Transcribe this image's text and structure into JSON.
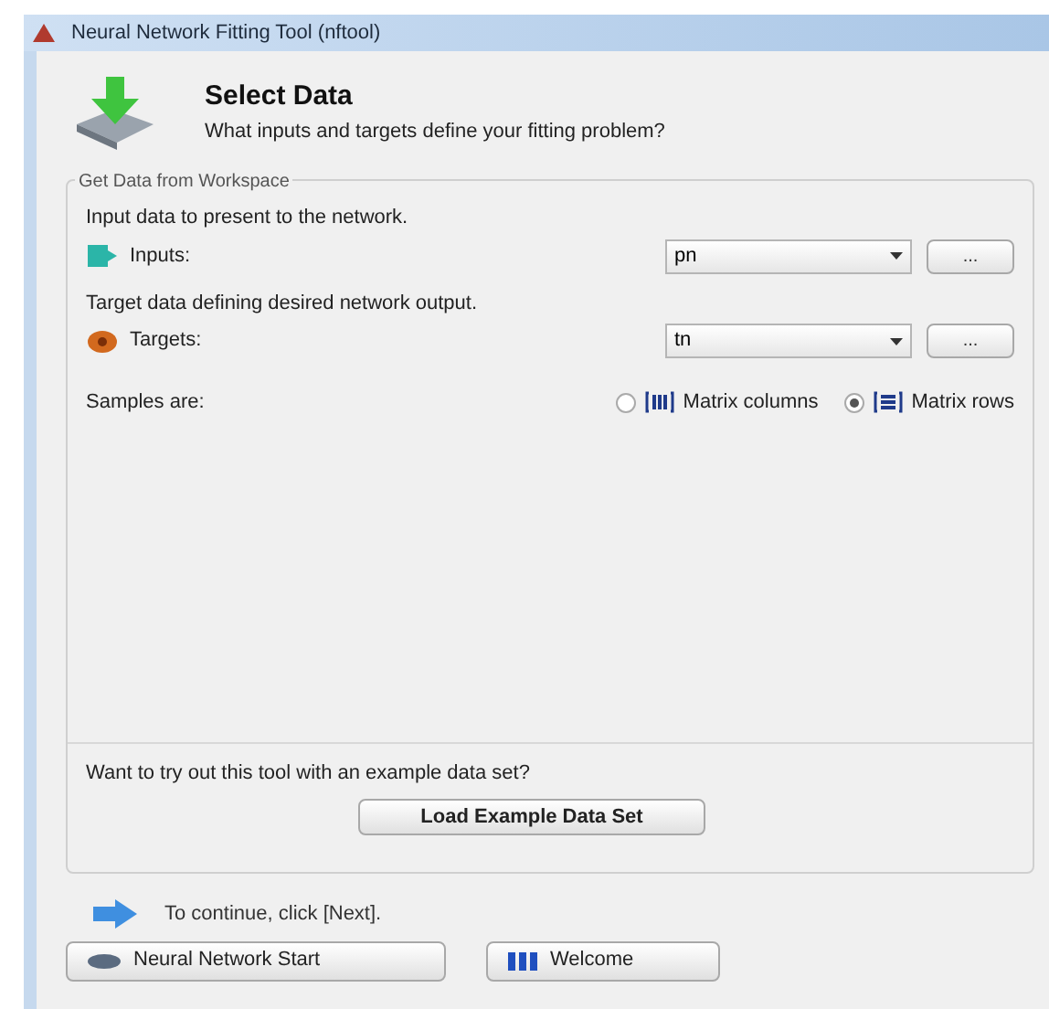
{
  "window": {
    "title": "Neural Network Fitting Tool (nftool)"
  },
  "header": {
    "title": "Select Data",
    "subtitle": "What inputs and targets define your fitting problem?"
  },
  "group": {
    "title": "Get Data from Workspace",
    "fields": [
      {
        "kind": "inputs",
        "hint": "Input data to present to the network.",
        "label": "Inputs:",
        "value": "pn",
        "browse": "..."
      },
      {
        "kind": "targets",
        "hint": "Target data defining desired network output.",
        "label": "Targets:",
        "value": "tn",
        "browse": "..."
      }
    ],
    "samples": {
      "label": "Samples are:",
      "options": [
        {
          "kind": "columns",
          "label": "Matrix columns",
          "selected": false
        },
        {
          "kind": "rows",
          "label": "Matrix rows",
          "selected": true
        }
      ]
    },
    "example": {
      "prompt": "Want to try out this tool with an example data set?",
      "button": "Load Example Data Set"
    }
  },
  "footer": {
    "hint": "To continue, click [Next].",
    "buttons": [
      {
        "kind": "start",
        "label": "Neural Network Start"
      },
      {
        "kind": "welcome",
        "label": "Welcome"
      }
    ]
  }
}
